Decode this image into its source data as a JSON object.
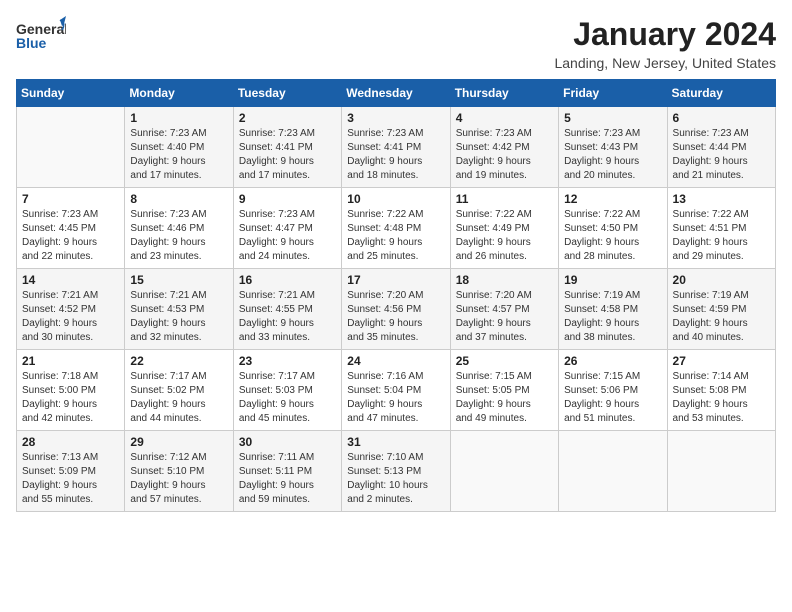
{
  "logo": {
    "general": "General",
    "blue": "Blue"
  },
  "title": "January 2024",
  "location": "Landing, New Jersey, United States",
  "days_header": [
    "Sunday",
    "Monday",
    "Tuesday",
    "Wednesday",
    "Thursday",
    "Friday",
    "Saturday"
  ],
  "weeks": [
    [
      {
        "day": "",
        "info": ""
      },
      {
        "day": "1",
        "info": "Sunrise: 7:23 AM\nSunset: 4:40 PM\nDaylight: 9 hours\nand 17 minutes."
      },
      {
        "day": "2",
        "info": "Sunrise: 7:23 AM\nSunset: 4:41 PM\nDaylight: 9 hours\nand 17 minutes."
      },
      {
        "day": "3",
        "info": "Sunrise: 7:23 AM\nSunset: 4:41 PM\nDaylight: 9 hours\nand 18 minutes."
      },
      {
        "day": "4",
        "info": "Sunrise: 7:23 AM\nSunset: 4:42 PM\nDaylight: 9 hours\nand 19 minutes."
      },
      {
        "day": "5",
        "info": "Sunrise: 7:23 AM\nSunset: 4:43 PM\nDaylight: 9 hours\nand 20 minutes."
      },
      {
        "day": "6",
        "info": "Sunrise: 7:23 AM\nSunset: 4:44 PM\nDaylight: 9 hours\nand 21 minutes."
      }
    ],
    [
      {
        "day": "7",
        "info": "Sunrise: 7:23 AM\nSunset: 4:45 PM\nDaylight: 9 hours\nand 22 minutes."
      },
      {
        "day": "8",
        "info": "Sunrise: 7:23 AM\nSunset: 4:46 PM\nDaylight: 9 hours\nand 23 minutes."
      },
      {
        "day": "9",
        "info": "Sunrise: 7:23 AM\nSunset: 4:47 PM\nDaylight: 9 hours\nand 24 minutes."
      },
      {
        "day": "10",
        "info": "Sunrise: 7:22 AM\nSunset: 4:48 PM\nDaylight: 9 hours\nand 25 minutes."
      },
      {
        "day": "11",
        "info": "Sunrise: 7:22 AM\nSunset: 4:49 PM\nDaylight: 9 hours\nand 26 minutes."
      },
      {
        "day": "12",
        "info": "Sunrise: 7:22 AM\nSunset: 4:50 PM\nDaylight: 9 hours\nand 28 minutes."
      },
      {
        "day": "13",
        "info": "Sunrise: 7:22 AM\nSunset: 4:51 PM\nDaylight: 9 hours\nand 29 minutes."
      }
    ],
    [
      {
        "day": "14",
        "info": "Sunrise: 7:21 AM\nSunset: 4:52 PM\nDaylight: 9 hours\nand 30 minutes."
      },
      {
        "day": "15",
        "info": "Sunrise: 7:21 AM\nSunset: 4:53 PM\nDaylight: 9 hours\nand 32 minutes."
      },
      {
        "day": "16",
        "info": "Sunrise: 7:21 AM\nSunset: 4:55 PM\nDaylight: 9 hours\nand 33 minutes."
      },
      {
        "day": "17",
        "info": "Sunrise: 7:20 AM\nSunset: 4:56 PM\nDaylight: 9 hours\nand 35 minutes."
      },
      {
        "day": "18",
        "info": "Sunrise: 7:20 AM\nSunset: 4:57 PM\nDaylight: 9 hours\nand 37 minutes."
      },
      {
        "day": "19",
        "info": "Sunrise: 7:19 AM\nSunset: 4:58 PM\nDaylight: 9 hours\nand 38 minutes."
      },
      {
        "day": "20",
        "info": "Sunrise: 7:19 AM\nSunset: 4:59 PM\nDaylight: 9 hours\nand 40 minutes."
      }
    ],
    [
      {
        "day": "21",
        "info": "Sunrise: 7:18 AM\nSunset: 5:00 PM\nDaylight: 9 hours\nand 42 minutes."
      },
      {
        "day": "22",
        "info": "Sunrise: 7:17 AM\nSunset: 5:02 PM\nDaylight: 9 hours\nand 44 minutes."
      },
      {
        "day": "23",
        "info": "Sunrise: 7:17 AM\nSunset: 5:03 PM\nDaylight: 9 hours\nand 45 minutes."
      },
      {
        "day": "24",
        "info": "Sunrise: 7:16 AM\nSunset: 5:04 PM\nDaylight: 9 hours\nand 47 minutes."
      },
      {
        "day": "25",
        "info": "Sunrise: 7:15 AM\nSunset: 5:05 PM\nDaylight: 9 hours\nand 49 minutes."
      },
      {
        "day": "26",
        "info": "Sunrise: 7:15 AM\nSunset: 5:06 PM\nDaylight: 9 hours\nand 51 minutes."
      },
      {
        "day": "27",
        "info": "Sunrise: 7:14 AM\nSunset: 5:08 PM\nDaylight: 9 hours\nand 53 minutes."
      }
    ],
    [
      {
        "day": "28",
        "info": "Sunrise: 7:13 AM\nSunset: 5:09 PM\nDaylight: 9 hours\nand 55 minutes."
      },
      {
        "day": "29",
        "info": "Sunrise: 7:12 AM\nSunset: 5:10 PM\nDaylight: 9 hours\nand 57 minutes."
      },
      {
        "day": "30",
        "info": "Sunrise: 7:11 AM\nSunset: 5:11 PM\nDaylight: 9 hours\nand 59 minutes."
      },
      {
        "day": "31",
        "info": "Sunrise: 7:10 AM\nSunset: 5:13 PM\nDaylight: 10 hours\nand 2 minutes."
      },
      {
        "day": "",
        "info": ""
      },
      {
        "day": "",
        "info": ""
      },
      {
        "day": "",
        "info": ""
      }
    ]
  ]
}
